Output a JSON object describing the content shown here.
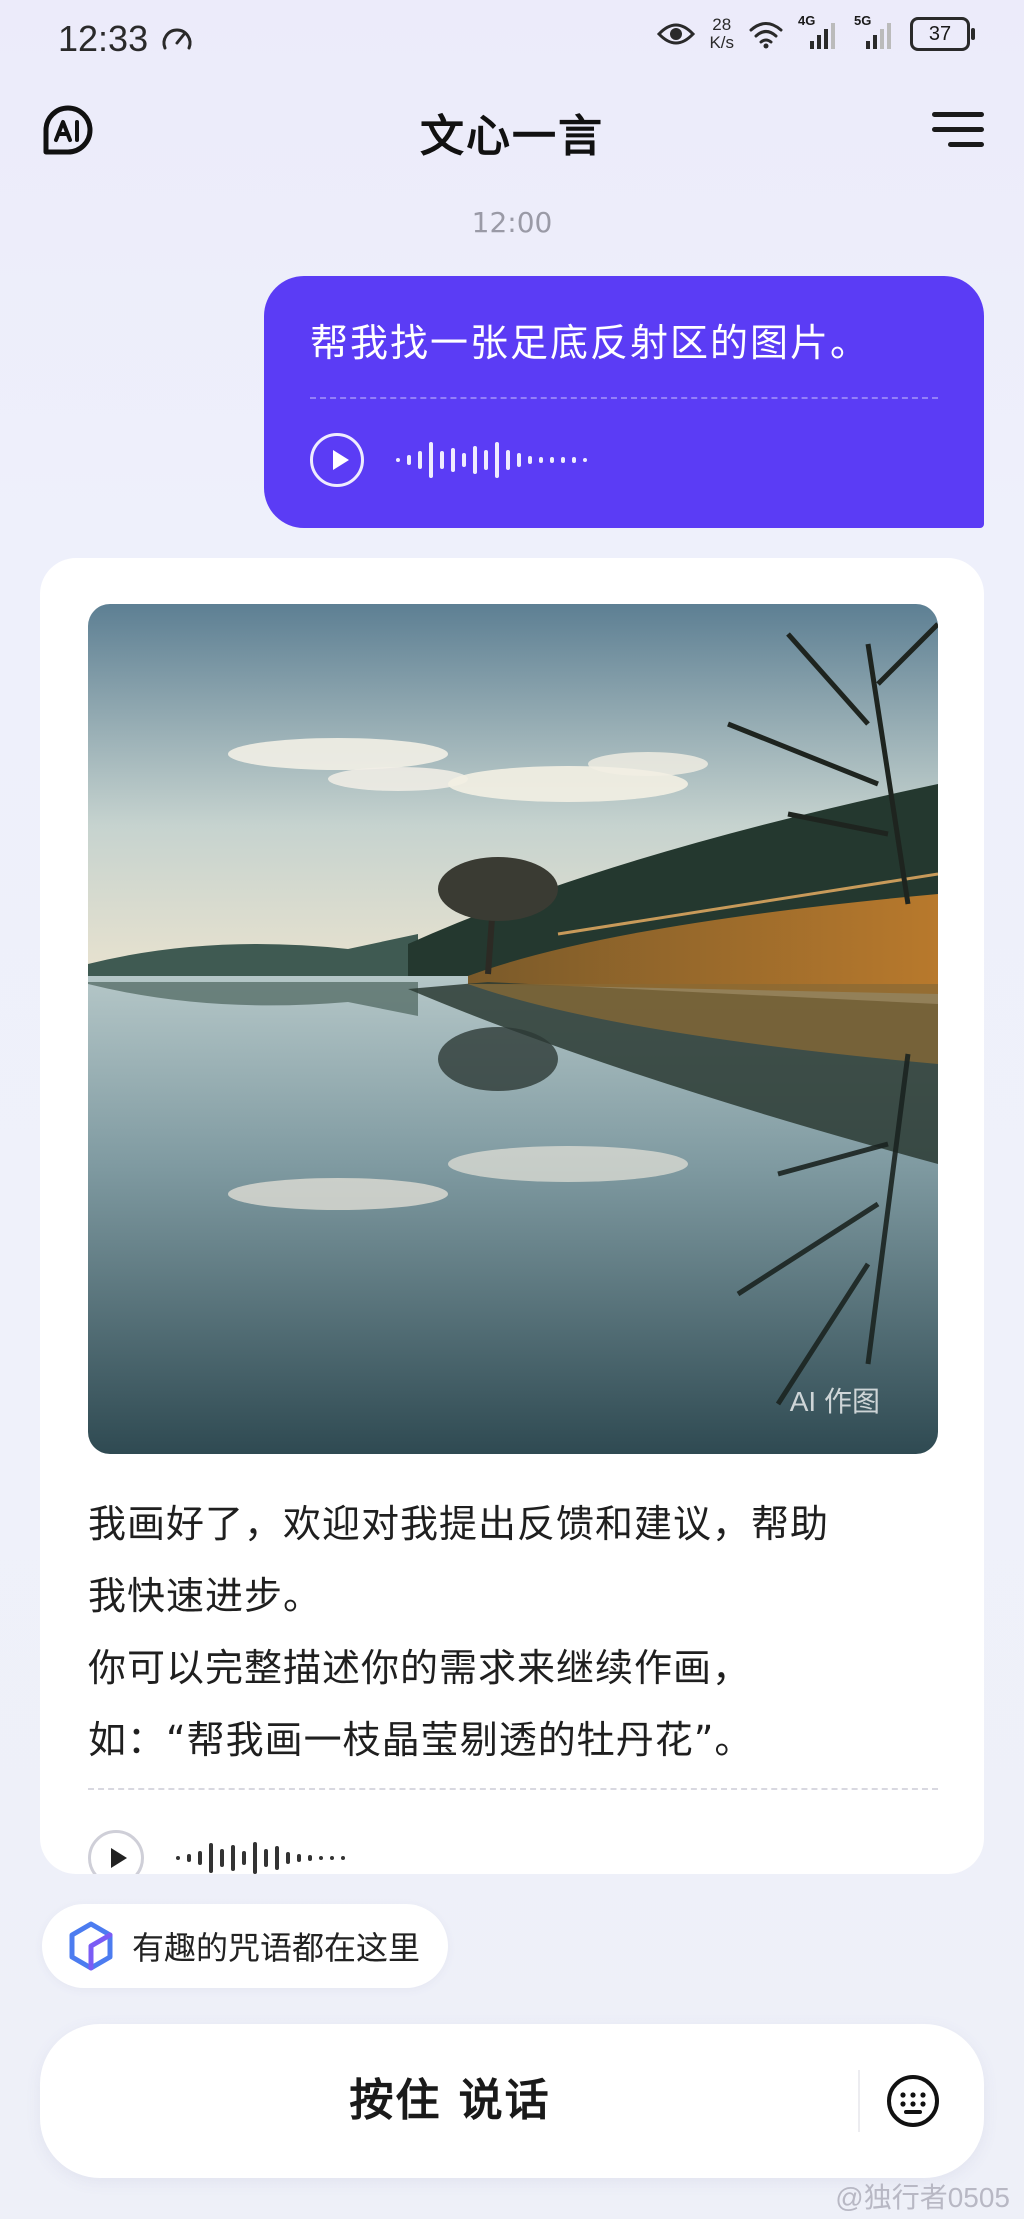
{
  "status_bar": {
    "time": "12:33",
    "net_speed_value": "28",
    "net_speed_unit": "K/s",
    "net_labels": [
      "4G",
      "5G"
    ],
    "battery": "37"
  },
  "header": {
    "title": "文心一言",
    "logo_text": "AI"
  },
  "chat": {
    "timestamp": "12:00",
    "user_message": "帮我找一张足底反射区的图片。",
    "ai_badge": "AI 作图",
    "ai_reply_lines": [
      "我画好了，欢迎对我提出反馈和建议，帮助",
      "我快速进步。",
      "你可以完整描述你的需求来继续作画，",
      "如：“帮我画一枝晶莹剔透的牡丹花”。"
    ]
  },
  "suggestion": {
    "label": "有趣的咒语都在这里"
  },
  "input": {
    "hold_to_talk": "按住 说话"
  },
  "watermark": "@独行者0505",
  "colors": {
    "accent": "#5b3cf5",
    "background": "#eef0f8"
  },
  "icons": {
    "logo": "ai-logo-icon",
    "menu": "menu-icon",
    "play": "play-icon",
    "keyboard": "keyboard-icon",
    "suggestion": "cube-icon"
  }
}
